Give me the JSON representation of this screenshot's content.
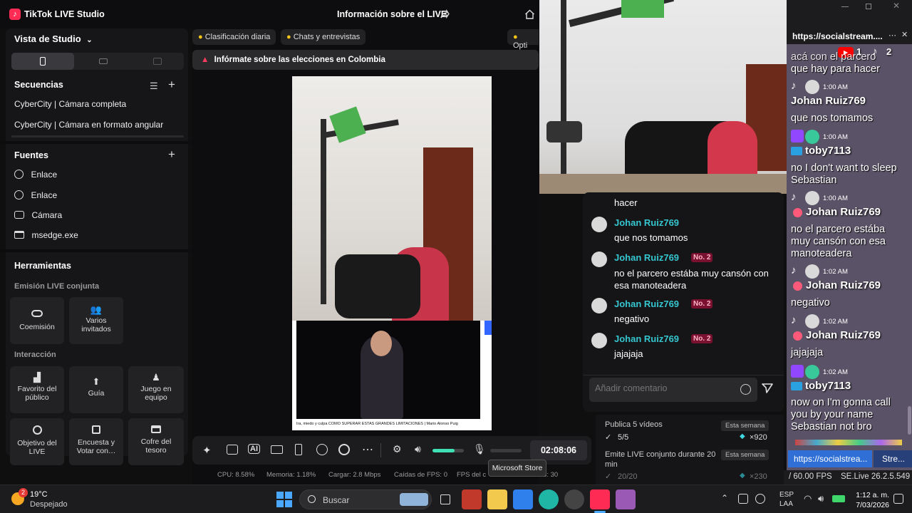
{
  "app": {
    "title": "TikTok LIVE Studio",
    "center_title": "Información sobre el LIVE"
  },
  "sidebar": {
    "view_label": "Vista de Studio",
    "sequences_title": "Secuencias",
    "sequences": [
      "CyberCity | Cámara completa",
      "CyberCity | Cámara en formato angular"
    ],
    "sources_title": "Fuentes",
    "sources": [
      {
        "label": "Enlace",
        "icon": "globe-icon"
      },
      {
        "label": "Enlace",
        "icon": "globe-icon"
      },
      {
        "label": "Cámara",
        "icon": "camera-icon"
      },
      {
        "label": "msedge.exe",
        "icon": "window-icon"
      }
    ],
    "tools_title": "Herramientas",
    "cohost_title": "Emisión LIVE conjunta",
    "cohost_tiles": [
      "Coemisión",
      "Varios invitados"
    ],
    "interaction_title": "Interacción",
    "interaction_tiles": [
      "Favorito del público",
      "Guía",
      "Juego en equipo",
      "Objetivo del LIVE",
      "Encuesta y Votar con…",
      "Cofre del tesoro"
    ]
  },
  "main": {
    "pills": [
      "Clasificación diaria",
      "Chats y entrevistas",
      "Opti"
    ],
    "notice": "Infórmate sobre las elecciones en Colombia",
    "video_caption": "Ira, miedo y culpa CÓMO SUPERAR ESTAS GRANDES LIMITACIONES | Mario Alonso Puig",
    "timer": "02:08:06",
    "volume_level": 0.7
  },
  "status": {
    "cpu": "CPU:  8.58%",
    "memory": "Memoria:  1.18%",
    "upload": "Cargar:  2.8 Mbps",
    "fps_drops": "Caídas de FPS:  0",
    "fps_label": "FPS del c",
    "fps_value": "S:  30",
    "tooltip": "Microsoft Store"
  },
  "chat": {
    "partial": "hacer",
    "messages": [
      {
        "user": "Johan Ruiz769",
        "badge": "",
        "text": "que nos tomamos"
      },
      {
        "user": "Johan Ruiz769",
        "badge": "No. 2",
        "text": "no el parcero estába muy cansón con esa manoteadera"
      },
      {
        "user": "Johan Ruiz769",
        "badge": "No. 2",
        "text": "negativo"
      },
      {
        "user": "Johan Ruiz769",
        "badge": "No. 2",
        "text": "jajajaja"
      }
    ],
    "placeholder": "Añadir comentario"
  },
  "tasks": [
    {
      "title": "Publica 5 vídeos",
      "tag": "Esta semana",
      "progress": "5/5",
      "reward": "×920"
    },
    {
      "title": "Emite LIVE conjunto durante 20 min",
      "tag": "Esta semana",
      "progress": "20/20",
      "reward": "×230"
    }
  ],
  "socialstream": {
    "url_title": "https://socialstream....",
    "yt_count": "1",
    "tt_count": "2",
    "top_text": "acá con el parcero",
    "top_text2": "que hay para hacer",
    "messages": [
      {
        "platform": "tiktok",
        "time": "1:00 AM",
        "name": "Johan Ruiz769",
        "text": "que nos tomamos"
      },
      {
        "platform": "twitch",
        "time": "1:00 AM",
        "name": "toby7113",
        "text": "no I don't want to sleep Sebastian"
      },
      {
        "platform": "tiktok",
        "time": "1:00 AM",
        "name": "Johan Ruiz769",
        "text": "no el parcero estába muy cansón con esa manoteadera"
      },
      {
        "platform": "tiktok",
        "time": "1:02 AM",
        "name": "Johan Ruiz769",
        "text": "negativo"
      },
      {
        "platform": "tiktok",
        "time": "1:02 AM",
        "name": "Johan Ruiz769",
        "text": "jajajaja"
      },
      {
        "platform": "twitch",
        "time": "1:02 AM",
        "name": "toby7113",
        "text": "now on I'm gonna call you by your name Sebastian not bro"
      }
    ],
    "tab1": "https://socialstrea...",
    "tab2": "Stre...",
    "fps": "/ 60.00 FPS",
    "version": "SE.Live 26.2.5.549"
  },
  "taskbar": {
    "weather_badge": "2",
    "temp": "19°C",
    "condition": "Despejado",
    "search_placeholder": "Buscar",
    "lang1": "ESP",
    "lang2": "LAA",
    "time": "1:12 a. m.",
    "date": "7/03/2026"
  }
}
